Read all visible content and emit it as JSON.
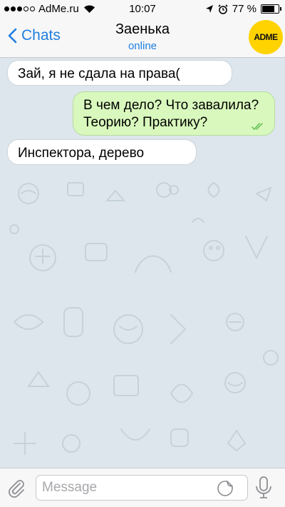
{
  "status_bar": {
    "carrier": "AdMe.ru",
    "time": "10:07",
    "battery_percent_label": "77 %",
    "battery_level": 0.77,
    "icons": [
      "signal-dots-icon",
      "wifi-icon",
      "location-arrow-icon",
      "alarm-clock-icon",
      "battery-icon"
    ]
  },
  "nav": {
    "back_label": "Chats",
    "title": "Заенька",
    "subtitle": "online",
    "avatar_text": "ADME"
  },
  "messages": [
    {
      "direction": "incoming",
      "text": "Зай, я не сдала на права("
    },
    {
      "direction": "outgoing",
      "lines": [
        "В чем дело? Что завалила?",
        "Теорию? Практику?"
      ],
      "read": true
    },
    {
      "direction": "incoming",
      "text": "Инспектора, дерево"
    }
  ],
  "input_bar": {
    "placeholder": "Message",
    "icons": [
      "paperclip-icon",
      "sticker-icon",
      "microphone-icon"
    ]
  },
  "colors": {
    "accent": "#1f7ee0",
    "outgoing_bubble": "#d9f8bd",
    "incoming_bubble": "#ffffff",
    "chat_background": "#dde6ec",
    "read_checks": "#5bbd52",
    "avatar_bg": "#ffd300"
  }
}
